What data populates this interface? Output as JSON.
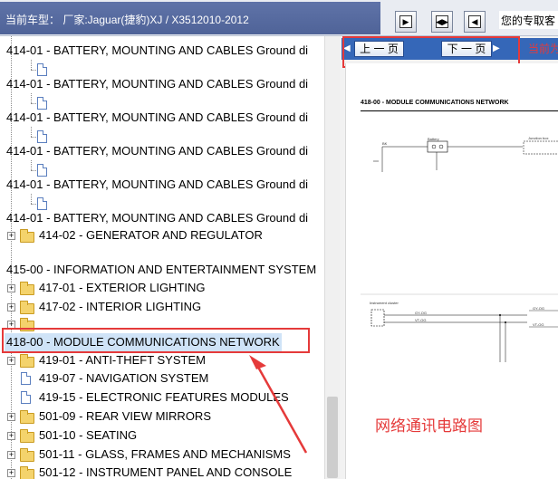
{
  "header": {
    "title": "当前车型： 厂家:Jaguar(捷豹)XJ / X3512010-2012",
    "right_title": "您的专取客"
  },
  "tree": {
    "rows": [
      {
        "label": "414-01 - BATTERY, MOUNTING AND CABLES Ground di",
        "type": "text-with-doc-child"
      },
      {
        "label": "414-01 - BATTERY, MOUNTING AND CABLES Ground di",
        "type": "text-with-doc-child"
      },
      {
        "label": "414-01 - BATTERY, MOUNTING AND CABLES Ground di",
        "type": "text-with-doc-child"
      },
      {
        "label": "414-01 - BATTERY, MOUNTING AND CABLES Ground di",
        "type": "text-with-doc-child"
      },
      {
        "label": "414-01 - BATTERY, MOUNTING AND CABLES Ground di",
        "type": "text-with-doc-child"
      },
      {
        "label": "414-01 - BATTERY, MOUNTING AND CABLES Ground di",
        "type": "text"
      },
      {
        "label": "414-02 - GENERATOR AND REGULATOR",
        "type": "folder"
      },
      {
        "label": "415-00 - INFORMATION AND ENTERTAINMENT SYSTEM",
        "type": "text"
      },
      {
        "label": "417-01 - EXTERIOR LIGHTING",
        "type": "folder"
      },
      {
        "label": "417-02 - INTERIOR LIGHTING",
        "type": "folder"
      },
      {
        "label": "",
        "type": "folder"
      },
      {
        "label": "418-00 - MODULE COMMUNICATIONS NETWORK",
        "type": "selected"
      },
      {
        "label": "419-01 - ANTI-THEFT SYSTEM",
        "type": "folder"
      },
      {
        "label": "419-07 - NAVIGATION SYSTEM",
        "type": "doc"
      },
      {
        "label": "419-15 - ELECTRONIC FEATURES MODULES",
        "type": "doc"
      },
      {
        "label": "501-09 - REAR VIEW MIRRORS",
        "type": "folder"
      },
      {
        "label": "501-10 - SEATING",
        "type": "folder"
      },
      {
        "label": "501-11 - GLASS, FRAMES AND MECHANISMS",
        "type": "folder"
      },
      {
        "label": "501-12 - INSTRUMENT PANEL AND CONSOLE",
        "type": "folder"
      }
    ]
  },
  "viewer": {
    "prev_label": "上 一 页",
    "next_label": "下 一 页",
    "side_label": "当前为",
    "page_heading": "418-00 - MODULE COMMUNICATIONS NETWORK",
    "diagram_labels": {
      "battery": "Battery",
      "junction_box": "Junction box",
      "instrument_cluster": "Instrument cluster",
      "bk": "BK",
      "gy_og": "GY-OG",
      "vt_og": "VT-OG"
    }
  },
  "annotation": {
    "caption": "网络通讯电路图"
  },
  "colors": {
    "highlight": "#e53a3a",
    "title_band": "#5468a0",
    "pager_bar": "#3567b8",
    "selected_row": "#cfe3f7"
  }
}
